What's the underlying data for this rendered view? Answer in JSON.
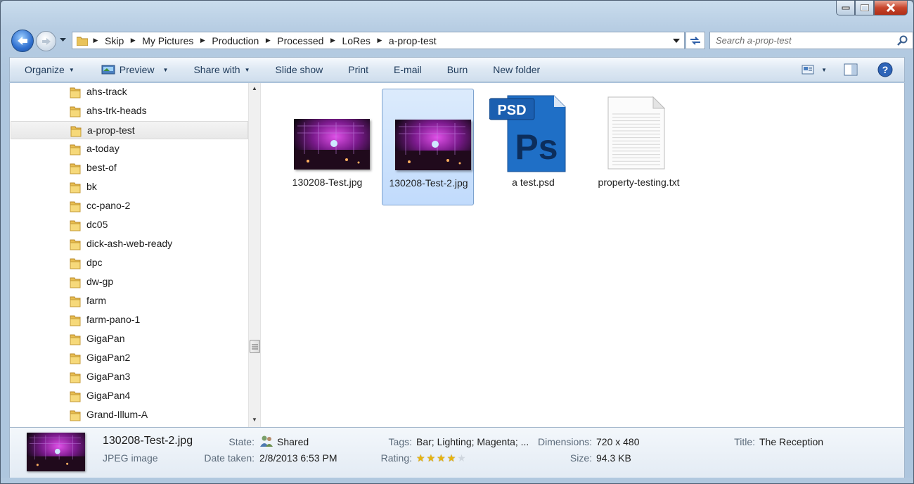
{
  "window": {
    "title": "a-prop-test"
  },
  "address": {
    "crumbs": [
      "Skip",
      "My Pictures",
      "Production",
      "Processed",
      "LoRes",
      "a-prop-test"
    ]
  },
  "search": {
    "placeholder": "Search a-prop-test"
  },
  "toolbar": {
    "organize": "Organize",
    "preview": "Preview",
    "share_with": "Share with",
    "slide_show": "Slide show",
    "print": "Print",
    "email": "E-mail",
    "burn": "Burn",
    "new_folder": "New folder"
  },
  "tree": [
    "ahs-track",
    "ahs-trk-heads",
    "a-prop-test",
    "a-today",
    "best-of",
    "bk",
    "cc-pano-2",
    "dc05",
    "dick-ash-web-ready",
    "dpc",
    "dw-gp",
    "farm",
    "farm-pano-1",
    "GigaPan",
    "GigaPan2",
    "GigaPan3",
    "GigaPan4",
    "Grand-Illum-A"
  ],
  "tree_selected_index": 2,
  "files": [
    {
      "name": "130208-Test.jpg",
      "kind": "photo",
      "selected": false
    },
    {
      "name": "130208-Test-2.jpg",
      "kind": "photo",
      "selected": true
    },
    {
      "name": "a test.psd",
      "kind": "psd",
      "selected": false
    },
    {
      "name": "property-testing.txt",
      "kind": "text",
      "selected": false
    }
  ],
  "details": {
    "filename": "130208-Test-2.jpg",
    "filetype": "JPEG image",
    "state_label": "State:",
    "state_value": "Shared",
    "date_label": "Date taken:",
    "date_value": "2/8/2013 6:53 PM",
    "tags_label": "Tags:",
    "tags_value": "Bar; Lighting; Magenta; ...",
    "rating_label": "Rating:",
    "rating": 4,
    "rating_max": 5,
    "dimensions_label": "Dimensions:",
    "dimensions_value": "720 x 480",
    "size_label": "Size:",
    "size_value": "94.3 KB",
    "title_label": "Title:",
    "title_value": "The Reception"
  },
  "colors": {
    "selection": "#cce0fb",
    "accent": "#1e3a5a",
    "psd_blue": "#1f6fc6"
  }
}
